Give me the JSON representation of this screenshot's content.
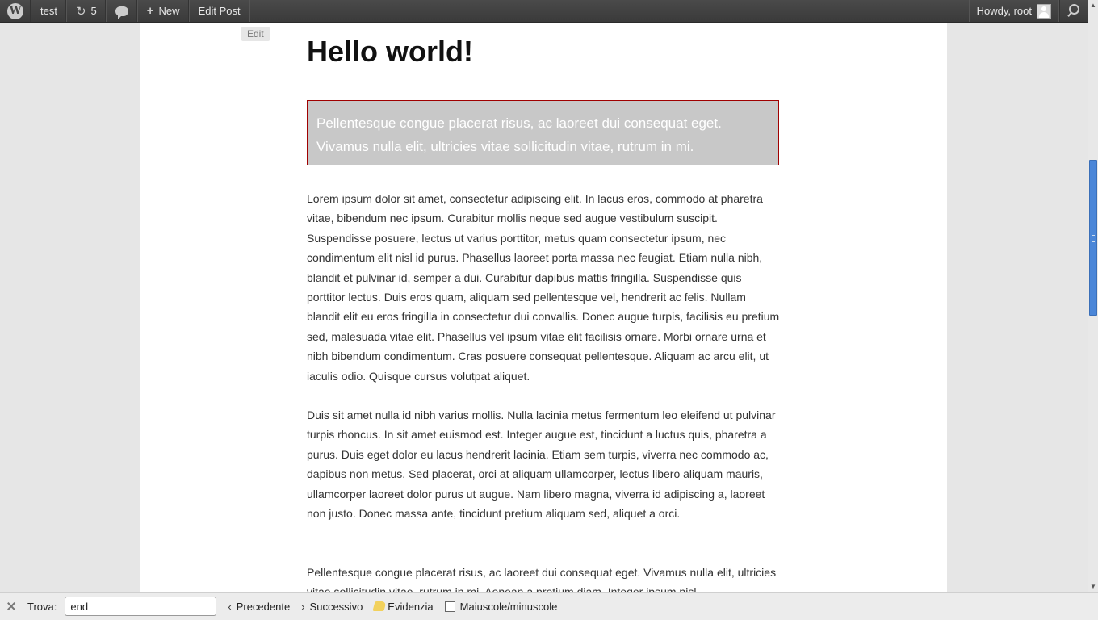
{
  "adminbar": {
    "wp_logo": "W",
    "site_name": "test",
    "updates_count": "5",
    "refresh_icon": "↻",
    "new_label": "New",
    "edit_post_label": "Edit Post",
    "howdy": "Howdy, root"
  },
  "post": {
    "edit_label": "Edit",
    "title": "Hello world!",
    "callout": "Pellentesque congue placerat risus, ac laoreet dui consequat eget. Vivamus nulla elit, ultricies vitae sollicitudin vitae, rutrum in mi.",
    "paragraphs": [
      "Lorem ipsum dolor sit amet, consectetur adipiscing elit. In lacus eros, commodo at pharetra vitae, bibendum nec ipsum. Curabitur mollis neque sed augue vestibulum suscipit. Suspendisse posuere, lectus ut varius porttitor, metus quam consectetur ipsum, nec condimentum elit nisl id purus. Phasellus laoreet porta massa nec feugiat. Etiam nulla nibh, blandit et pulvinar id, semper a dui. Curabitur dapibus mattis fringilla. Suspendisse quis porttitor lectus. Duis eros quam, aliquam sed pellentesque vel, hendrerit ac felis. Nullam blandit elit eu eros fringilla in consectetur dui convallis. Donec augue turpis, facilisis eu pretium sed, malesuada vitae elit. Phasellus vel ipsum vitae elit facilisis ornare. Morbi ornare urna et nibh bibendum condimentum. Cras posuere consequat pellentesque. Aliquam ac arcu elit, ut iaculis odio. Quisque cursus volutpat aliquet.",
      "Duis sit amet nulla id nibh varius mollis. Nulla lacinia metus fermentum leo eleifend ut pulvinar turpis rhoncus. In sit amet euismod est. Integer augue est, tincidunt a luctus quis, pharetra a purus. Duis eget dolor eu lacus hendrerit lacinia. Etiam sem turpis, viverra nec commodo ac, dapibus non metus. Sed placerat, orci at aliquam ullamcorper, lectus libero aliquam mauris, ullamcorper laoreet dolor purus ut augue. Nam libero magna, viverra id adipiscing a, laoreet non justo. Donec massa ante, tincidunt pretium aliquam sed, aliquet a orci.",
      "Pellentesque congue placerat risus, ac laoreet dui consequat eget. Vivamus nulla elit, ultricies vitae sollicitudin vitae, rutrum in mi. Aenean a pretium diam. Integer ipsum nisl"
    ]
  },
  "findbar": {
    "label": "Trova:",
    "query": "end",
    "prev_label": "Precedente",
    "next_label": "Successivo",
    "highlight_label": "Evidenzia",
    "match_case_label": "Maiuscole/minuscole",
    "match_case_checked": false
  },
  "colors": {
    "adminbar_bg": "#464646",
    "callout_bg": "#c8c8c8",
    "callout_border": "#a00000",
    "scroll_thumb": "#4a86d8"
  }
}
